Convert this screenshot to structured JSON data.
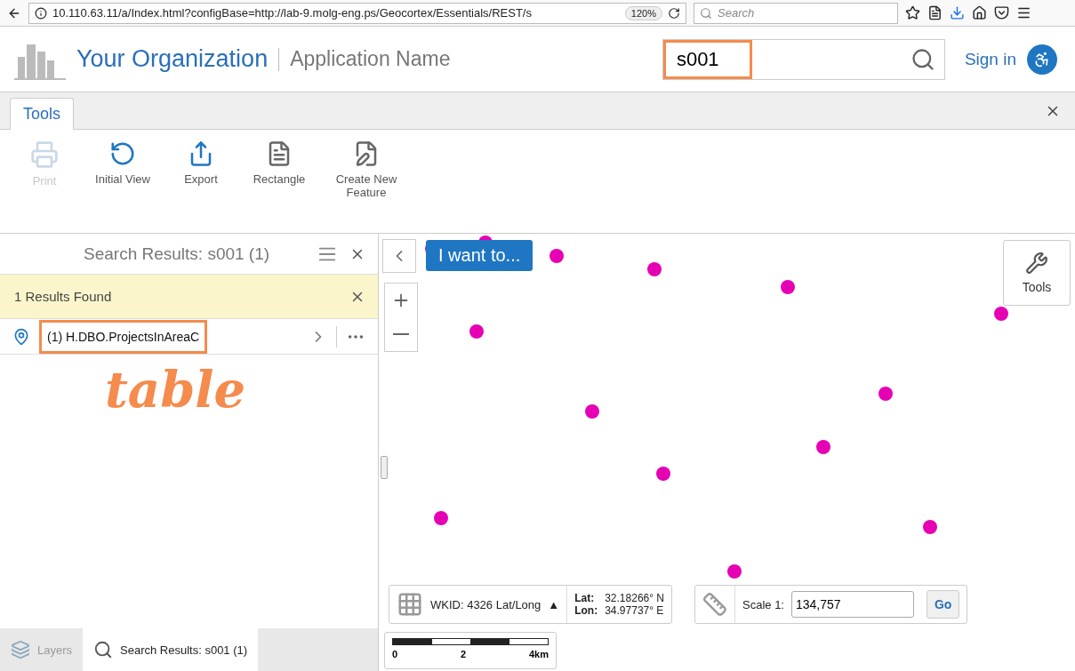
{
  "browser": {
    "url": "10.110.63.11/a/Index.html?configBase=http://lab-9.molg-eng.ps/Geocortex/Essentials/REST/s",
    "zoom": "120%",
    "search_placeholder": "Search"
  },
  "header": {
    "organization": "Your Organization",
    "application": "Application Name",
    "search": {
      "value": "s001",
      "highlighted": true
    },
    "sign_in": "Sign in"
  },
  "ribbon": {
    "tabs": [
      {
        "label": "Tools",
        "selected": true
      }
    ],
    "tools": [
      {
        "kind": "print",
        "label": "Print",
        "disabled": true
      },
      {
        "kind": "initial-view",
        "label": "Initial View",
        "disabled": false
      },
      {
        "kind": "export",
        "label": "Export",
        "disabled": false
      },
      {
        "kind": "rectangle",
        "label": "Rectangle",
        "disabled": false
      },
      {
        "kind": "create",
        "label": "Create New Feature",
        "disabled": false
      }
    ]
  },
  "results_panel": {
    "title": "Search Results: s001 (1)",
    "notice": "1 Results Found",
    "results": [
      {
        "label": "(1) H.DBO.ProjectsInAreaC",
        "highlighted": true
      }
    ],
    "annotation": "table"
  },
  "bottom_tabs": [
    {
      "kind": "layers",
      "label": "Layers",
      "selected": false
    },
    {
      "kind": "search",
      "label": "Search Results: s001 (1)",
      "selected": true
    }
  ],
  "map": {
    "kind": "picture",
    "i_want_to": "I want to...",
    "tools_button": "Tools",
    "coordinates": {
      "wkid": "WKID: 4326 Lat/Long",
      "arrow": "▲",
      "lat_label": "Lat:",
      "lat": "32.18266° N",
      "lon_label": "Lon:",
      "lon": "34.97737° E"
    },
    "scale": {
      "label": "Scale 1:",
      "value": "134,757",
      "go": "Go"
    },
    "scale_bar": [
      "0",
      "2",
      "4km"
    ]
  }
}
